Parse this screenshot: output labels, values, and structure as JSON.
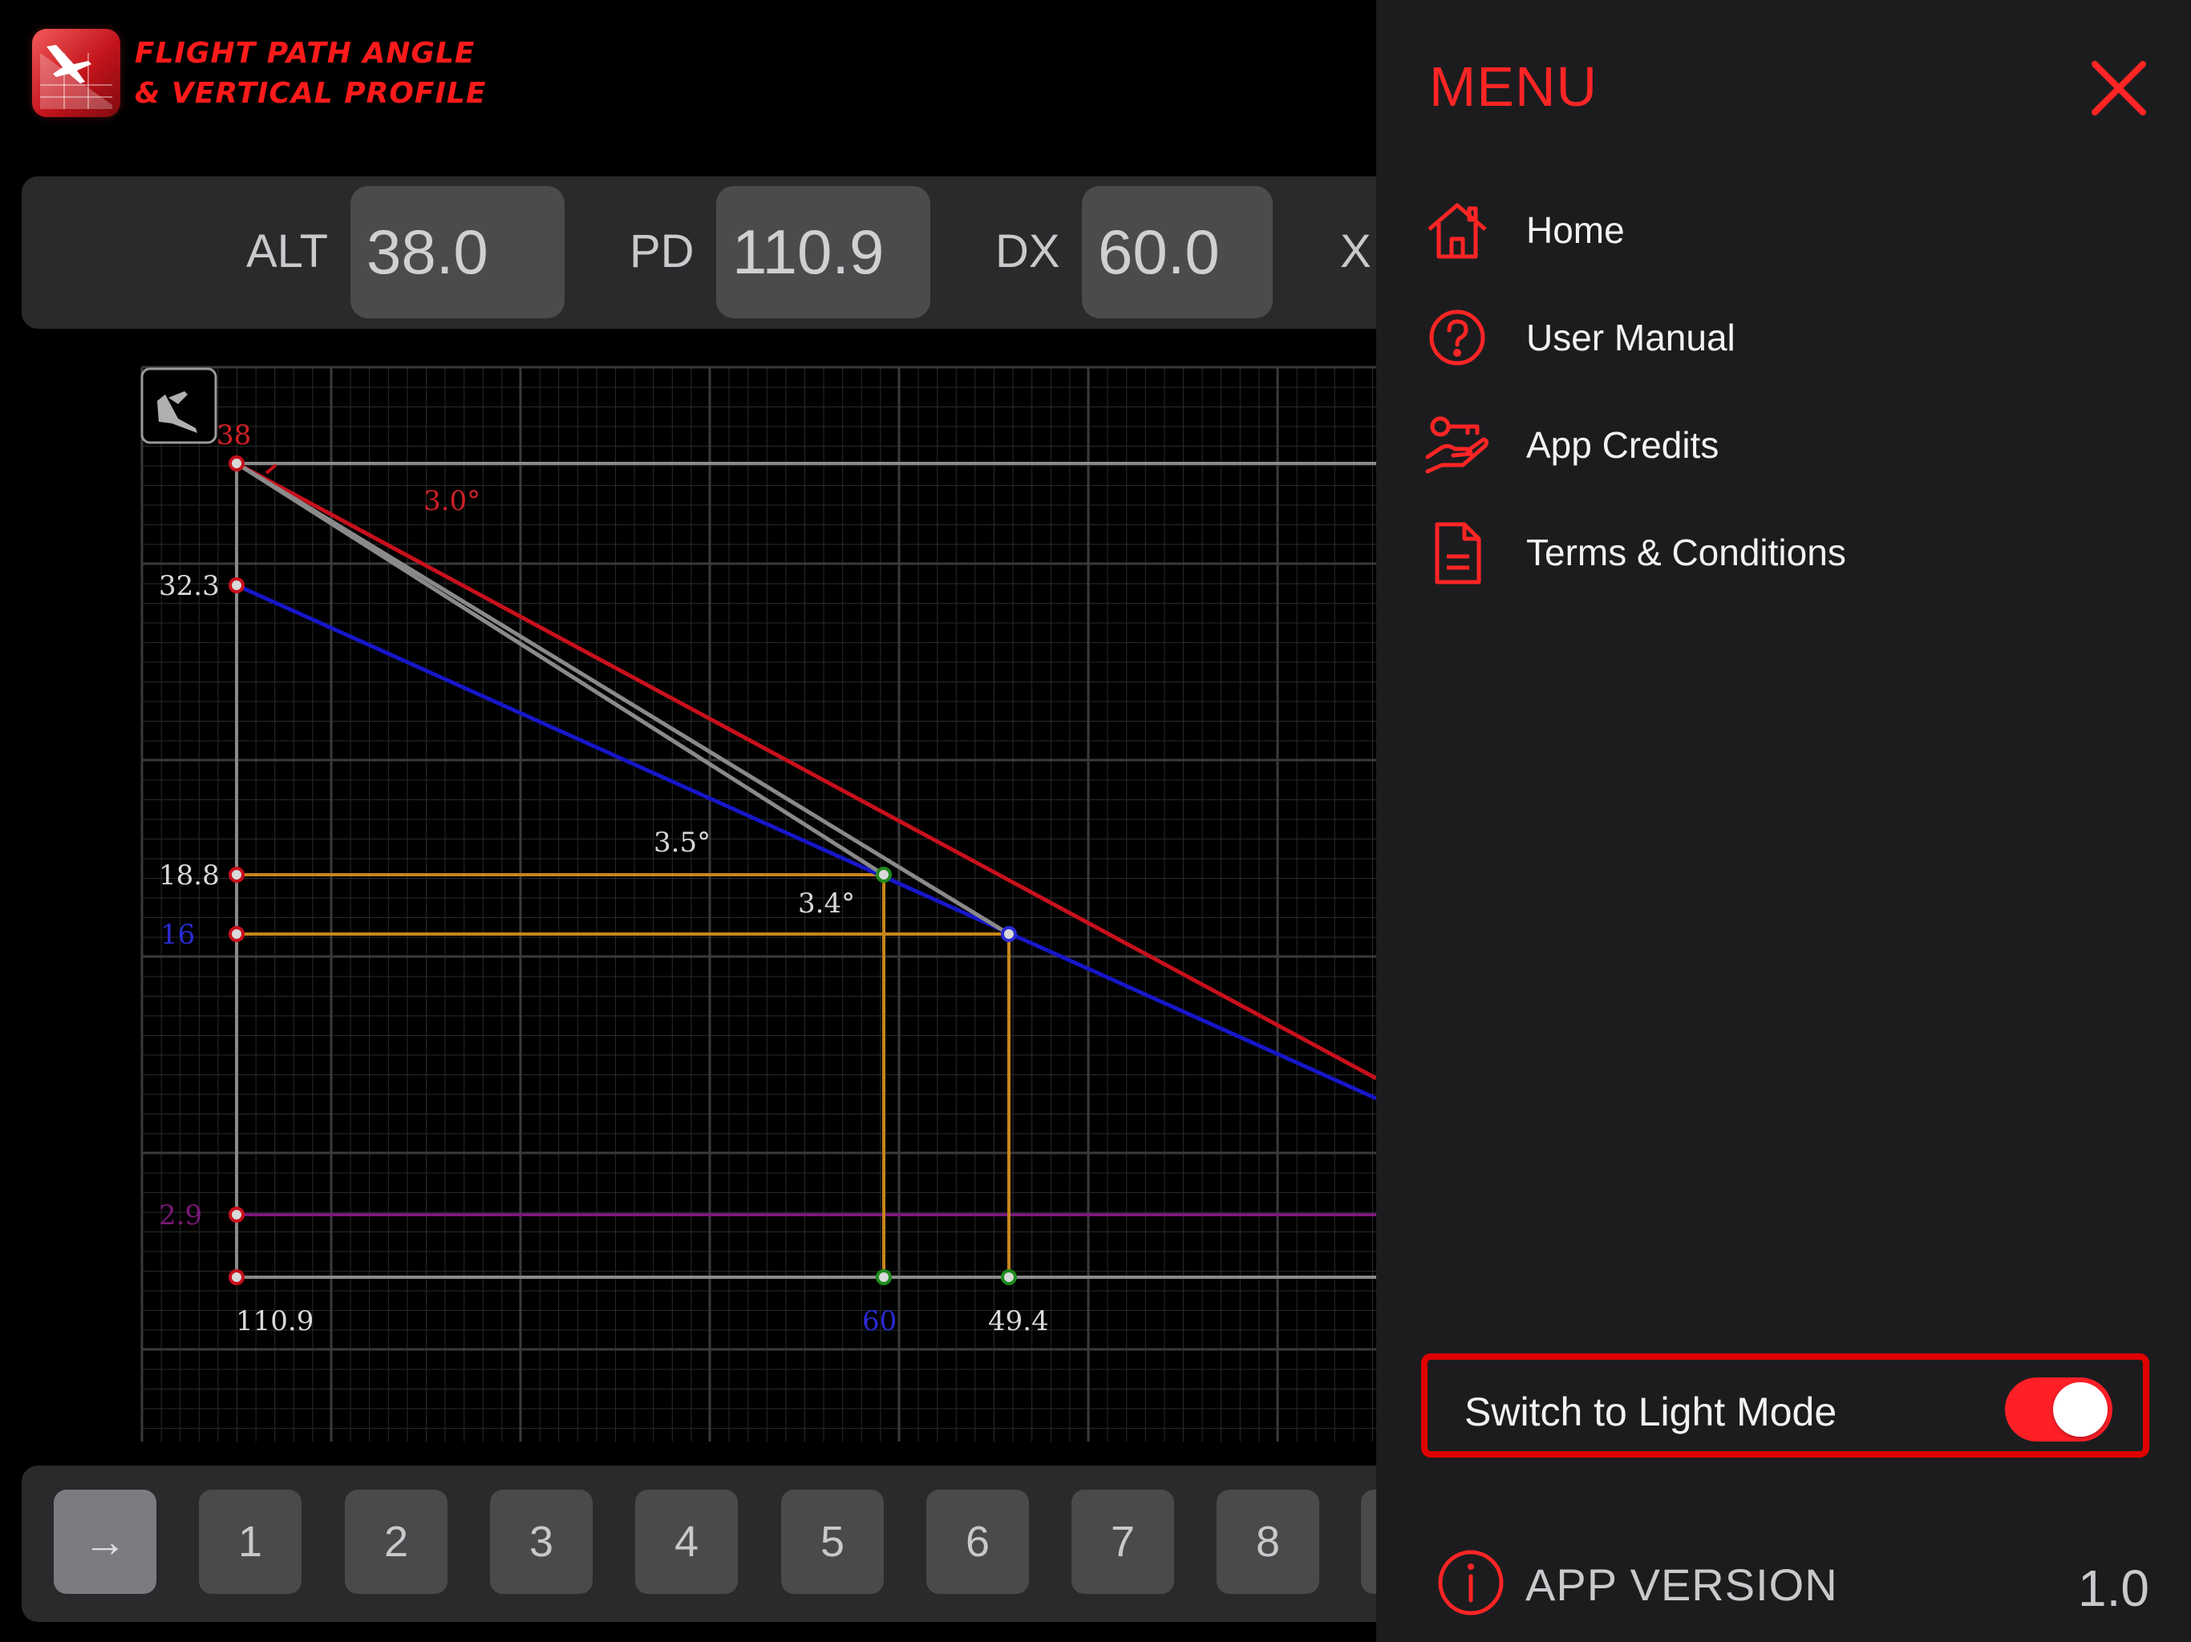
{
  "header": {
    "title_line1": "FLIGHT PATH ANGLE",
    "title_line2": "& VERTICAL PROFILE",
    "logo_icon": "descending-aircraft-logo-icon"
  },
  "inputs": [
    {
      "label": "ALT",
      "value": "38.0"
    },
    {
      "label": "PD",
      "value": "110.9"
    },
    {
      "label": "DX",
      "value": "60.0"
    },
    {
      "label": "X",
      "value": ""
    }
  ],
  "graph": {
    "mode_icon": "aircraft-mode-icon",
    "altitude_labels": [
      {
        "text": "38",
        "color": "#d21f26"
      },
      {
        "text": "32.3",
        "color": "#d9d9d9"
      },
      {
        "text": "18.8",
        "color": "#d9d9d9"
      },
      {
        "text": "16",
        "color": "#2b2bd6"
      },
      {
        "text": "2.9",
        "color": "#7a1a7a"
      }
    ],
    "distance_labels": [
      {
        "text": "110.9",
        "color": "#d9d9d9"
      },
      {
        "text": "60",
        "color": "#2b2bd6"
      },
      {
        "text": "49.4",
        "color": "#d9d9d9"
      }
    ],
    "angle_labels": [
      {
        "text": "3.0°",
        "color": "#d21f26"
      },
      {
        "text": "3.5°",
        "color": "#d9d9d9"
      },
      {
        "text": "3.4°",
        "color": "#d9d9d9"
      }
    ],
    "colors": {
      "red_path": "#c8101c",
      "blue_path": "#1616c8",
      "gray_path": "#8a8a8a",
      "orange_guides": "#c8851a",
      "purple_floor": "#7a1a7a",
      "grid": "#3a3a3c"
    }
  },
  "tabs": [
    {
      "label": "→",
      "icon": "arrow-right-icon"
    },
    {
      "label": "1"
    },
    {
      "label": "2"
    },
    {
      "label": "3"
    },
    {
      "label": "4"
    },
    {
      "label": "5"
    },
    {
      "label": "6"
    },
    {
      "label": "7"
    },
    {
      "label": "8"
    }
  ],
  "menu": {
    "title": "MENU",
    "close_icon": "close-icon",
    "items": [
      {
        "label": "Home",
        "icon": "home-icon"
      },
      {
        "label": "User Manual",
        "icon": "question-circle-icon"
      },
      {
        "label": "App Credits",
        "icon": "key-hand-icon"
      },
      {
        "label": "Terms & Conditions",
        "icon": "document-icon"
      }
    ],
    "light_mode": {
      "label": "Switch to Light Mode",
      "on": true
    },
    "version": {
      "label": "APP VERSION",
      "value": "1.0",
      "icon": "info-circle-icon"
    },
    "accent_color": "#ff2525"
  }
}
